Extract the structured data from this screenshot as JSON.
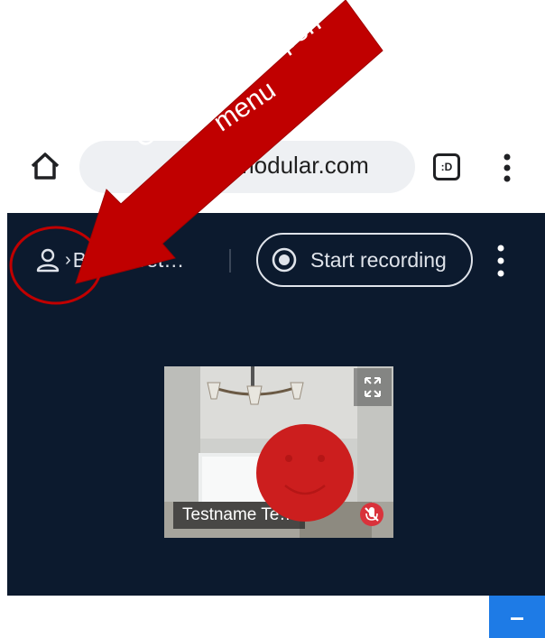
{
  "browser": {
    "url": "modular.com",
    "tabs_label": ":D",
    "icons": [
      "home-icon",
      "lock-icon",
      "tabs-icon",
      "menu-icon"
    ]
  },
  "meeting": {
    "room_name": "BLP Meet…",
    "record_label": "Start recording",
    "participant_name": "Testname Te…",
    "minus_label": "–"
  },
  "annotation": {
    "callout_text": "Click here to open menu",
    "color": "#c00000"
  },
  "colors": {
    "meeting_bg": "#0c1a2e",
    "accent_blue": "#1e7be6",
    "annotation_red": "#c00000"
  }
}
